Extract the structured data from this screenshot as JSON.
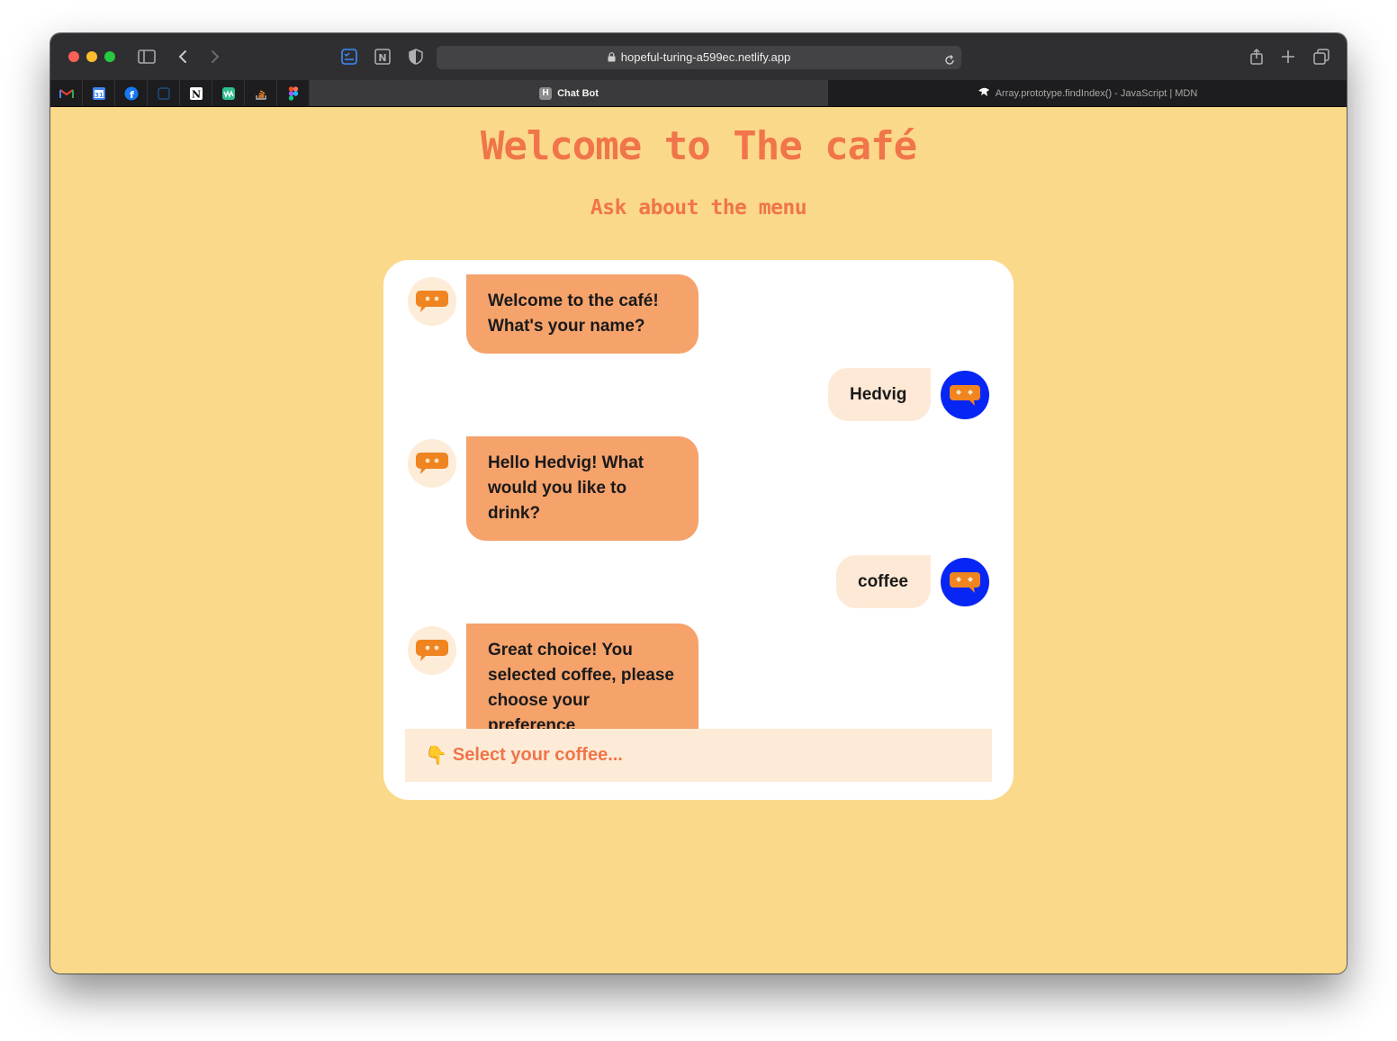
{
  "browser": {
    "url": "hopeful-turing-a599ec.netlify.app",
    "tabs": [
      {
        "label": "Chat Bot",
        "icon_letter": "H",
        "active": true
      },
      {
        "label": "Array.prototype.findIndex() - JavaScript | MDN",
        "active": false
      }
    ],
    "pinned_tabs": [
      "gmail-icon",
      "google-calendar-icon",
      "facebook-icon",
      "tab-icon",
      "notion-icon",
      "wavve-icon",
      "stackoverflow-icon",
      "figma-icon"
    ]
  },
  "page": {
    "title": "Welcome to The café",
    "subtitle": "Ask about the menu"
  },
  "chat": {
    "messages": [
      {
        "from": "bot",
        "text": "Welcome to the café! What's your name?"
      },
      {
        "from": "user",
        "text": "Hedvig"
      },
      {
        "from": "bot",
        "text": "Hello Hedvig! What would you like to drink?"
      },
      {
        "from": "user",
        "text": "coffee"
      },
      {
        "from": "bot",
        "text": "Great choice! You selected coffee, please choose your preference"
      }
    ],
    "select": {
      "icon": "👇",
      "placeholder": "Select your coffee..."
    }
  },
  "colors": {
    "page_bg": "#fbd98b",
    "accent": "#f0754a",
    "bot_bubble": "#f5a26b",
    "user_bubble": "#fde9d6",
    "user_avatar": "#0726f5"
  }
}
